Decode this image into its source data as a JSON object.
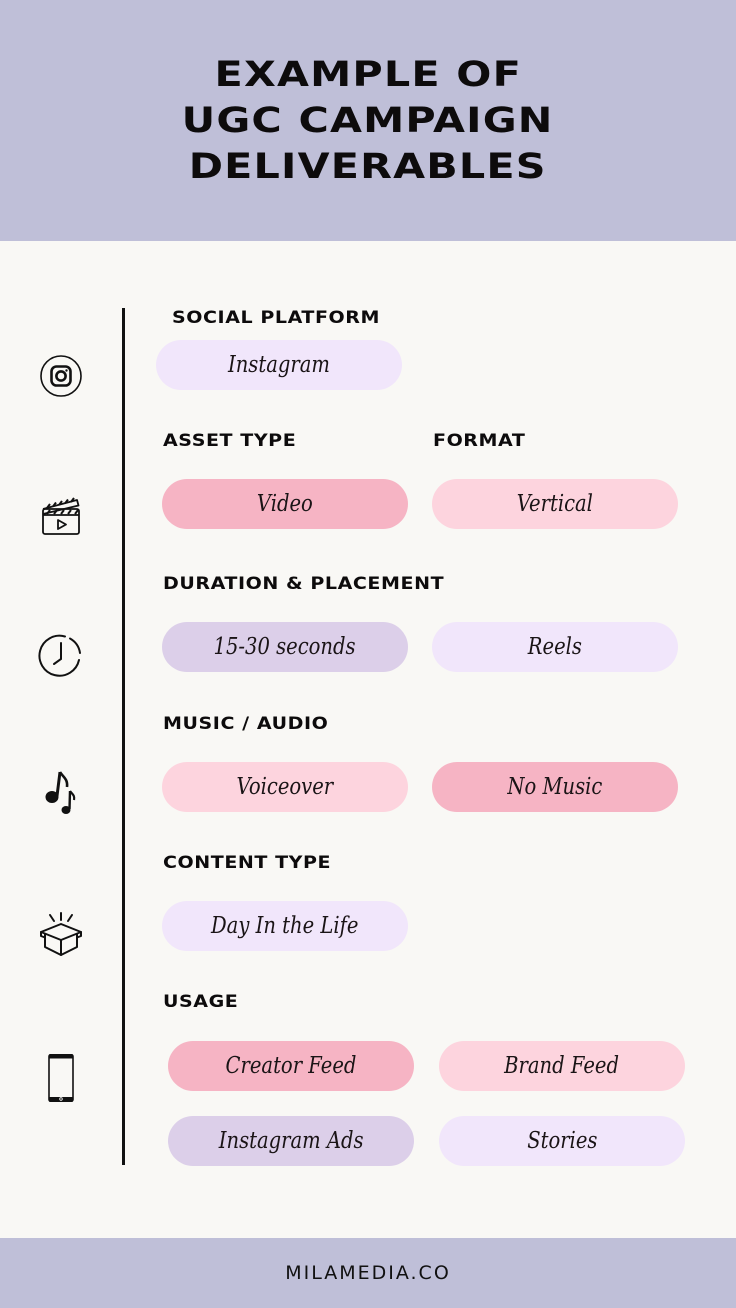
{
  "header": {
    "title_lines": [
      "EXAMPLE OF",
      "UGC CAMPAIGN",
      "DELIVERABLES"
    ]
  },
  "colors": {
    "header_bg": "#bfbfd8",
    "page_bg": "#f9f8f5",
    "pink_dark": "#f6b4c4",
    "pink_light": "#fdd4de",
    "lavender_dark": "#dccfe9",
    "lavender_light": "#f1e6fb"
  },
  "sections": [
    {
      "icon": "instagram-icon",
      "labels": [
        "SOCIAL PLATFORM"
      ],
      "pills": [
        {
          "text": "Instagram",
          "color": "#f1e6fb"
        }
      ]
    },
    {
      "icon": "clapperboard-icon",
      "labels": [
        "ASSET TYPE",
        "FORMAT"
      ],
      "pills": [
        {
          "text": "Video",
          "color": "#f6b4c4"
        },
        {
          "text": "Vertical",
          "color": "#fdd4de"
        }
      ]
    },
    {
      "icon": "clock-icon",
      "labels": [
        "DURATION & PLACEMENT"
      ],
      "pills": [
        {
          "text": "15-30 seconds",
          "color": "#dccfe9"
        },
        {
          "text": "Reels",
          "color": "#f1e6fb"
        }
      ]
    },
    {
      "icon": "music-notes-icon",
      "labels": [
        "MUSIC / AUDIO"
      ],
      "pills": [
        {
          "text": "Voiceover",
          "color": "#fdd4de"
        },
        {
          "text": "No Music",
          "color": "#f6b4c4"
        }
      ]
    },
    {
      "icon": "open-box-icon",
      "labels": [
        "CONTENT TYPE"
      ],
      "pills": [
        {
          "text": "Day In the Life",
          "color": "#f1e6fb"
        }
      ]
    },
    {
      "icon": "smartphone-icon",
      "labels": [
        "USAGE"
      ],
      "pills": [
        {
          "text": "Creator Feed",
          "color": "#f6b4c4"
        },
        {
          "text": "Brand Feed",
          "color": "#fdd4de"
        },
        {
          "text": "Instagram Ads",
          "color": "#dccfe9"
        },
        {
          "text": "Stories",
          "color": "#f1e6fb"
        }
      ]
    }
  ],
  "footer": {
    "text": "MILAMEDIA.CO"
  }
}
